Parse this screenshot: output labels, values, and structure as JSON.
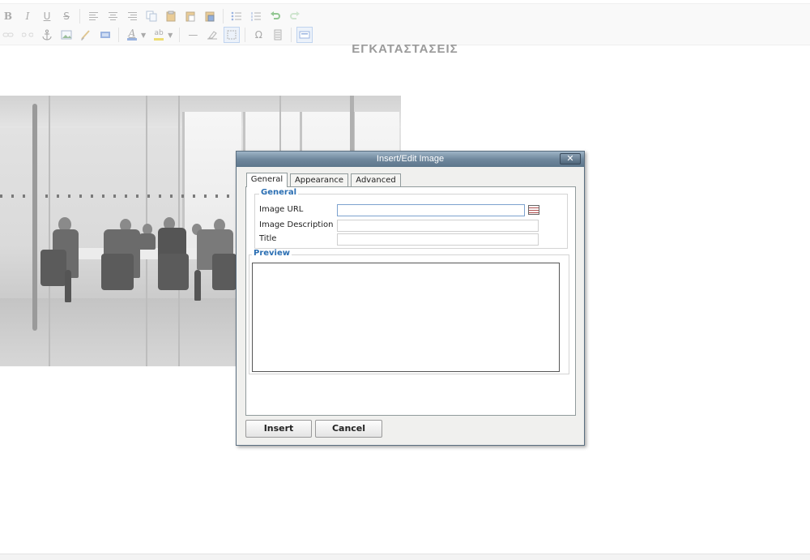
{
  "page": {
    "title": "ΕΓΚΑΤΑΣΤΑΣΕΙΣ"
  },
  "toolbar": {
    "bold": "B",
    "italic": "I",
    "underline": "U",
    "strike": "S",
    "font_color": "A",
    "bg_color": "ab",
    "special_char": "Ω",
    "hr": "—"
  },
  "dialog": {
    "title": "Insert/Edit Image",
    "close_label": "✕",
    "tabs": [
      {
        "label": "General",
        "active": true
      },
      {
        "label": "Appearance",
        "active": false
      },
      {
        "label": "Advanced",
        "active": false
      }
    ],
    "general": {
      "legend": "General",
      "image_url_label": "Image URL",
      "image_url_value": "",
      "description_label": "Image Description",
      "description_value": "",
      "title_label": "Title",
      "title_value": ""
    },
    "preview": {
      "legend": "Preview"
    },
    "buttons": {
      "insert": "Insert",
      "cancel": "Cancel"
    }
  },
  "colors": {
    "accent": "#2b6fb3",
    "titlebar": "#6f889d",
    "page_title": "#9a9a9a"
  },
  "icons": [
    "bold-icon",
    "italic-icon",
    "underline-icon",
    "strikethrough-icon",
    "align-left-icon",
    "align-center-icon",
    "align-right-icon",
    "copy-icon",
    "paste-icon",
    "paste-text-icon",
    "paste-word-icon",
    "bullet-list-icon",
    "numbered-list-icon",
    "undo-icon",
    "redo-icon",
    "link-icon",
    "unlink-icon",
    "anchor-icon",
    "image-icon",
    "cleanup-icon",
    "html-icon",
    "font-color-icon",
    "background-color-icon",
    "horizontal-rule-icon",
    "remove-format-icon",
    "visual-aid-icon",
    "special-char-icon",
    "page-break-icon",
    "fullscreen-icon",
    "close-icon",
    "browse-icon"
  ]
}
